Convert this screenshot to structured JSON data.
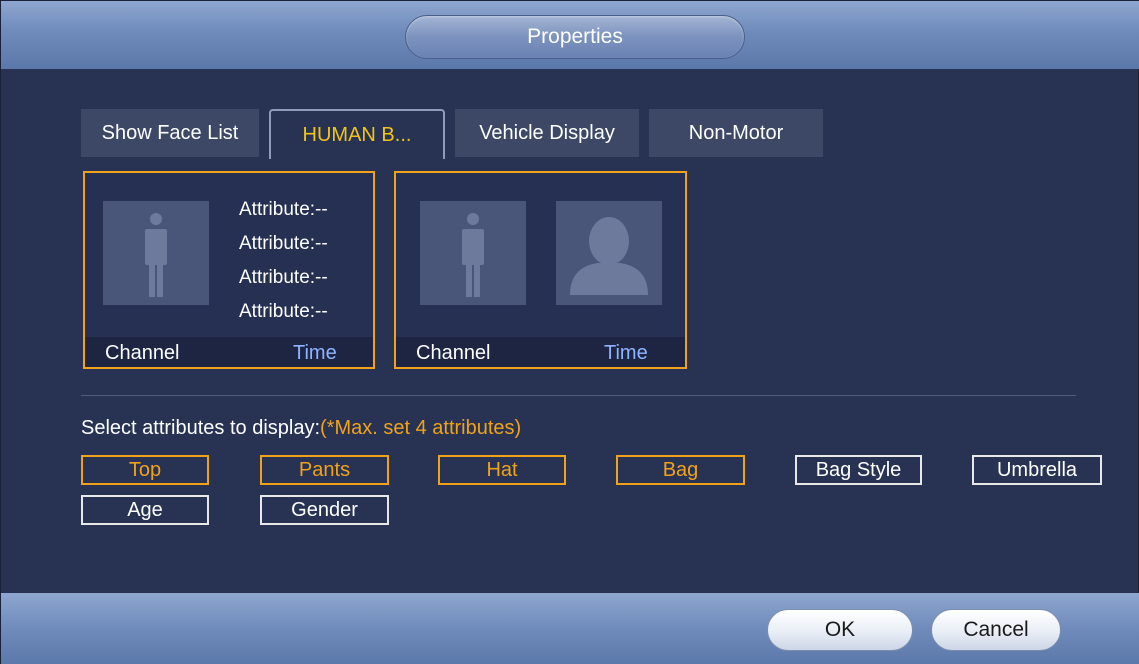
{
  "dialog": {
    "title": "Properties"
  },
  "tabs": [
    {
      "label": "Show Face List",
      "active": false
    },
    {
      "label": "HUMAN B...",
      "active": true
    },
    {
      "label": "Vehicle Display",
      "active": false
    },
    {
      "label": "Non-Motor",
      "active": false
    }
  ],
  "cards": {
    "human": {
      "attributes": [
        "Attribute:--",
        "Attribute:--",
        "Attribute:--",
        "Attribute:--"
      ],
      "channel": "Channel",
      "time": "Time",
      "thumb_icon": "person-body-icon"
    },
    "face": {
      "channel": "Channel",
      "time": "Time",
      "thumb_icons": [
        "person-body-icon",
        "face-silhouette-icon"
      ]
    }
  },
  "select": {
    "label": "Select attributes to display:",
    "hint": "(*Max. set 4 attributes)",
    "options": [
      {
        "label": "Top",
        "selected": true
      },
      {
        "label": "Pants",
        "selected": true
      },
      {
        "label": "Hat",
        "selected": true
      },
      {
        "label": "Bag",
        "selected": true
      },
      {
        "label": "Bag Style",
        "selected": false
      },
      {
        "label": "Umbrella",
        "selected": false
      },
      {
        "label": "Age",
        "selected": false
      },
      {
        "label": "Gender",
        "selected": false
      }
    ]
  },
  "footer": {
    "ok_label": "OK",
    "cancel_label": "Cancel"
  },
  "colors": {
    "accent": "#f0a21b",
    "tab_active_text": "#f2c318",
    "time_text": "#8fb4ff",
    "background": "#283353"
  }
}
